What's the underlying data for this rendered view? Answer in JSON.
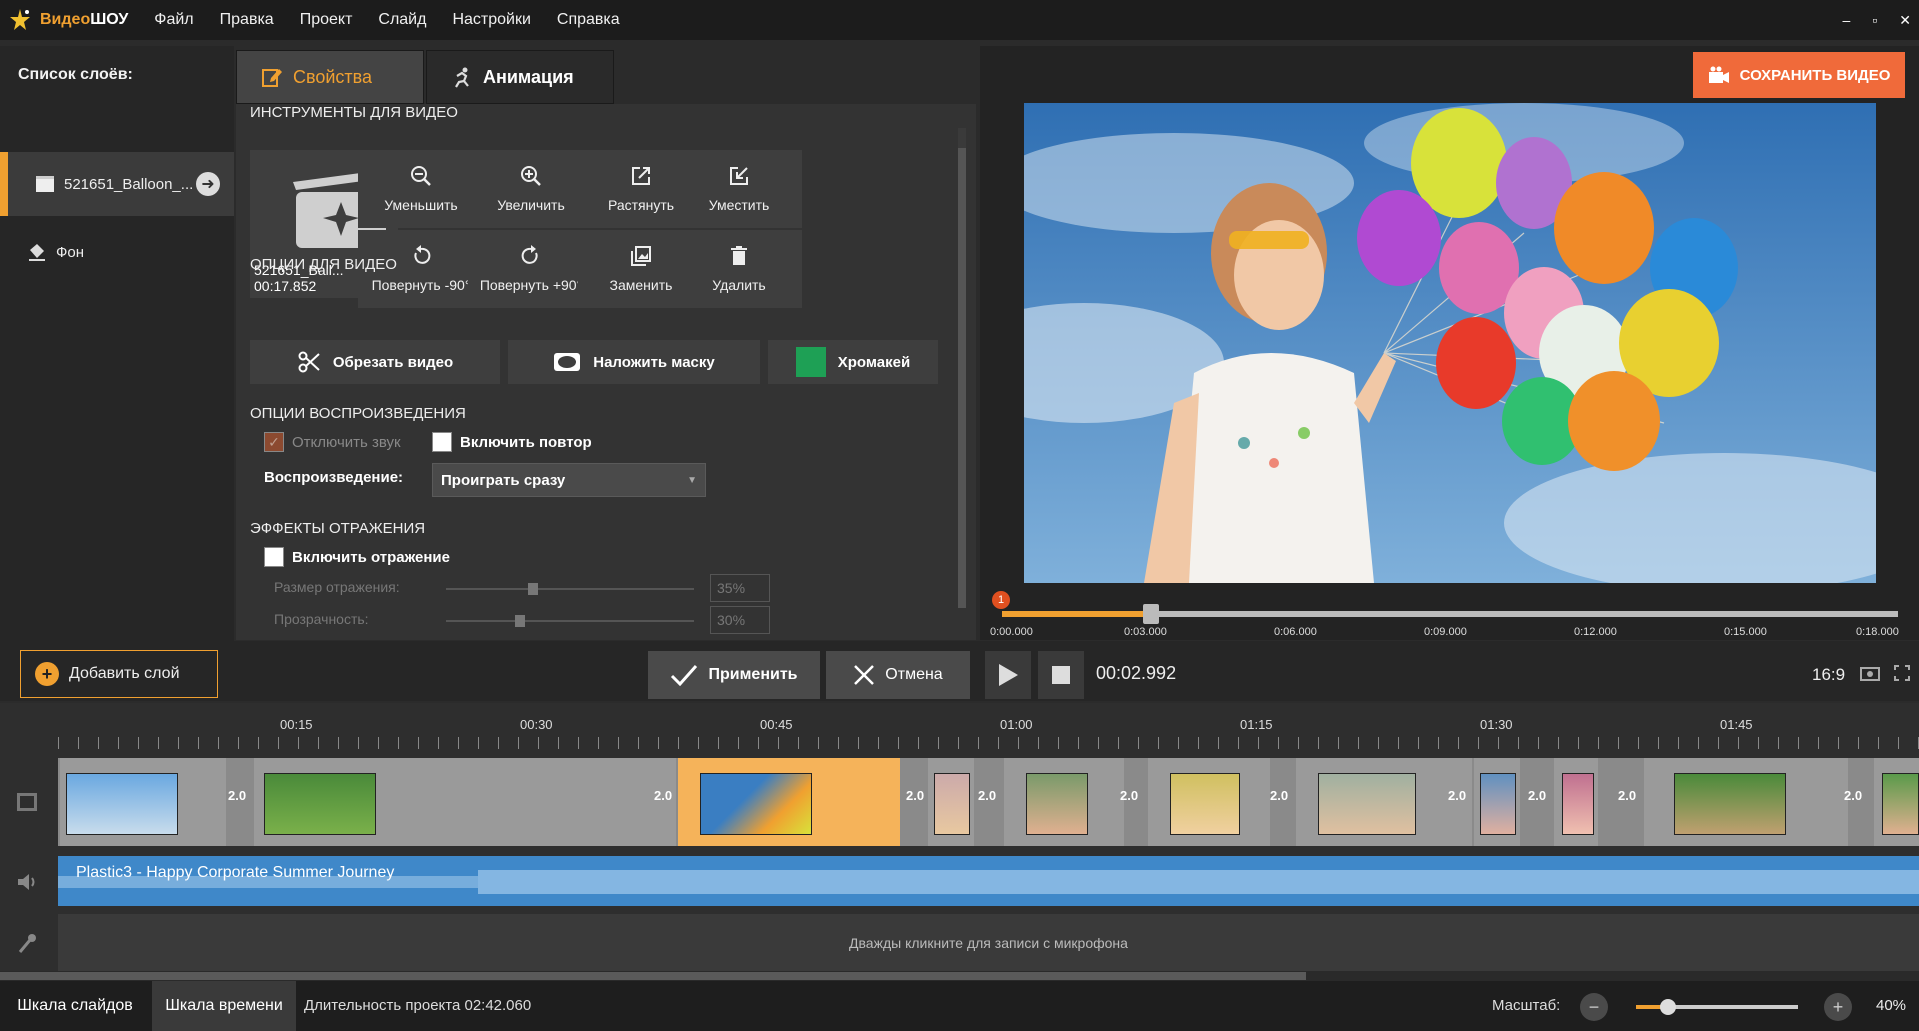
{
  "app": {
    "name_part1": "Видео",
    "name_part2": "ШОУ",
    "menu": [
      "Файл",
      "Правка",
      "Проект",
      "Слайд",
      "Настройки",
      "Справка"
    ],
    "window_controls": [
      "–",
      "▫",
      "✕"
    ]
  },
  "layers": {
    "title": "Список слоёв:",
    "items": [
      {
        "label": "521651_Balloon_...",
        "icon": "film-icon",
        "selected": true
      },
      {
        "label": "Фон",
        "icon": "paint-bucket-icon",
        "selected": false
      }
    ]
  },
  "tabs": {
    "properties": "Свойства",
    "animation": "Анимация"
  },
  "video_tools": {
    "header": "ИНСТРУМЕНТЫ ДЛЯ ВИДЕО",
    "thumb_name": "521651_Ball...",
    "thumb_duration": "00:17.852",
    "buttons": [
      {
        "label": "Уменьшить",
        "icon": "zoom-out-icon"
      },
      {
        "label": "Увеличить",
        "icon": "zoom-in-icon"
      },
      {
        "label": "Растянуть",
        "icon": "stretch-icon"
      },
      {
        "label": "Уместить",
        "icon": "fit-icon"
      },
      {
        "label": "Повернуть -90°",
        "icon": "rotate-left-icon"
      },
      {
        "label": "Повернуть +90°",
        "icon": "rotate-right-icon"
      },
      {
        "label": "Заменить",
        "icon": "replace-image-icon"
      },
      {
        "label": "Удалить",
        "icon": "trash-icon"
      }
    ]
  },
  "video_options": {
    "header": "ОПЦИИ ДЛЯ ВИДЕО",
    "trim": "Обрезать видео",
    "mask": "Наложить маску",
    "chroma": "Хромакей",
    "chroma_color": "#1ea055"
  },
  "playback": {
    "header": "ОПЦИИ ВОСПРОИЗВЕДЕНИЯ",
    "mute_label": "Отключить звук",
    "mute_checked": true,
    "repeat_label": "Включить повтор",
    "repeat_checked": false,
    "mode_label": "Воспроизведение:",
    "mode_value": "Проиграть сразу"
  },
  "reflection": {
    "header": "ЭФФЕКТЫ ОТРАЖЕНИЯ",
    "enable_label": "Включить отражение",
    "size_label": "Размер отражения:",
    "size_value": "35%",
    "size_fraction": 0.35,
    "opacity_label": "Прозрачность:",
    "opacity_value": "30%",
    "opacity_fraction": 0.3
  },
  "preview": {
    "save_button": "СОХРАНИТЬ ВИДЕО",
    "marker_number": "1",
    "ruler_labels": [
      "0:00.000",
      "0:03.000",
      "0:06.000",
      "0:09.000",
      "0:12.000",
      "0:15.000",
      "0:18.000"
    ],
    "progress_fraction": 0.166
  },
  "controls": {
    "add_layer": "Добавить слой",
    "apply": "Применить",
    "cancel": "Отмена",
    "timecode": "00:02.992",
    "aspect": "16:9"
  },
  "timeline": {
    "labels": [
      "00:15",
      "00:30",
      "00:45",
      "01:00",
      "01:15",
      "01:30",
      "01:45"
    ],
    "transition_value": "2.0",
    "audio_track": "Plastic3 - Happy Corporate Summer Journey",
    "mic_hint": "Дважды кликните для записи с микрофона"
  },
  "status": {
    "tab_slides": "Шкала слайдов",
    "tab_timeline": "Шкала времени",
    "duration": "Длительность проекта 02:42.060",
    "scale_label": "Масштаб:",
    "zoom": "40%",
    "zoom_fraction": 0.2
  }
}
